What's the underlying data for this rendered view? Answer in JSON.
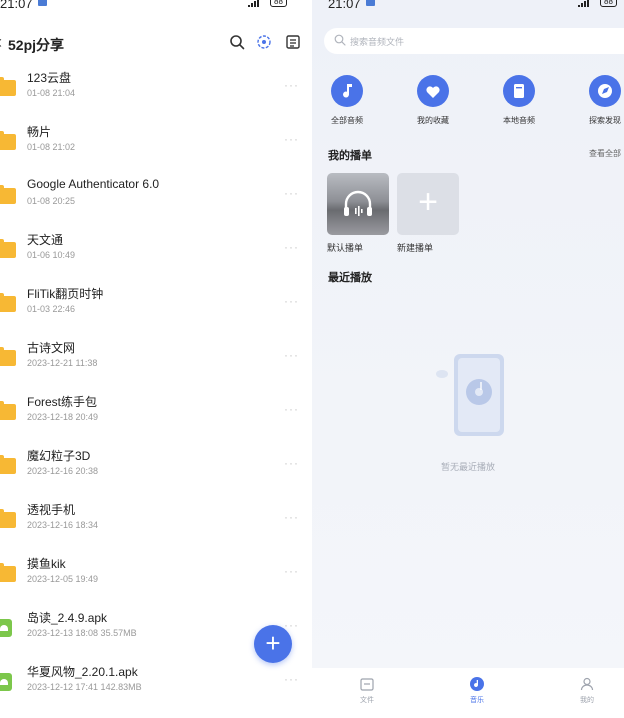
{
  "left": {
    "status": {
      "time": "21:07",
      "battery": "88"
    },
    "header": {
      "title": "52pj分享"
    },
    "files": [
      {
        "type": "folder",
        "name": "123云盘",
        "meta": "01-08 21:04"
      },
      {
        "type": "folder",
        "name": "畅片",
        "meta": "01-08 21:02"
      },
      {
        "type": "folder",
        "name": "Google Authenticator 6.0",
        "meta": "01-08 20:25"
      },
      {
        "type": "folder",
        "name": "天文通",
        "meta": "01-06 10:49"
      },
      {
        "type": "folder",
        "name": "FliTik翻页时钟",
        "meta": "01-03 22:46"
      },
      {
        "type": "folder",
        "name": "古诗文网",
        "meta": "2023-12-21 11:38"
      },
      {
        "type": "folder",
        "name": "Forest练手包",
        "meta": "2023-12-18 20:49"
      },
      {
        "type": "folder",
        "name": "魔幻粒子3D",
        "meta": "2023-12-16 20:38"
      },
      {
        "type": "folder",
        "name": "透视手机",
        "meta": "2023-12-16 18:34"
      },
      {
        "type": "folder",
        "name": "摸鱼kik",
        "meta": "2023-12-05 19:49"
      },
      {
        "type": "apk",
        "name": "岛读_2.4.9.apk",
        "meta": "2023-12-13 18:08  35.57MB"
      },
      {
        "type": "apk",
        "name": "华夏风物_2.20.1.apk",
        "meta": "2023-12-12 17:41  142.83MB"
      }
    ],
    "more_glyph": "···",
    "fab_glyph": "+"
  },
  "right": {
    "status": {
      "time": "21:07",
      "battery": "88"
    },
    "search": {
      "placeholder": "搜索音频文件"
    },
    "quick": [
      {
        "label": "全部音频",
        "icon": "music-note-icon"
      },
      {
        "label": "我的收藏",
        "icon": "heart-icon"
      },
      {
        "label": "本地音频",
        "icon": "local-file-icon"
      },
      {
        "label": "探索发现",
        "icon": "compass-icon"
      }
    ],
    "my_playlists": {
      "title": "我的播单",
      "see_all": "查看全部",
      "items": [
        {
          "label": "默认播单"
        },
        {
          "label": "新建播单",
          "glyph": "+"
        }
      ]
    },
    "recent": {
      "title": "最近播放",
      "empty_text": "暂无最近播放"
    },
    "nav": [
      {
        "label": "文件",
        "icon": "folder-outline-icon",
        "active": false
      },
      {
        "label": "音乐",
        "icon": "music-disc-icon",
        "active": true
      },
      {
        "label": "我的",
        "icon": "person-icon",
        "active": false
      }
    ]
  },
  "colors": {
    "accent": "#4a73e8",
    "folder": "#f7b834",
    "apk": "#7cc74b"
  }
}
